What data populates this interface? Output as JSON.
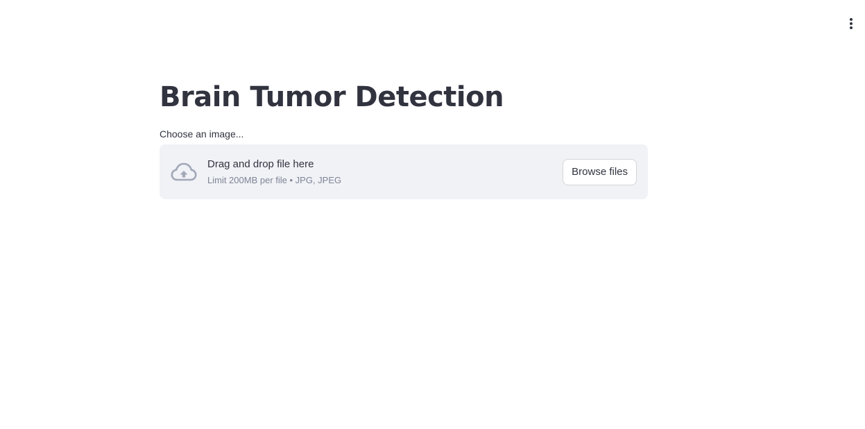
{
  "header": {
    "menu_icon": "vertical-dots-icon"
  },
  "main": {
    "title": "Brain Tumor Detection",
    "uploader": {
      "label": "Choose an image...",
      "drop_title": "Drag and drop file here",
      "limit_text": "Limit 200MB per file • JPG, JPEG",
      "browse_label": "Browse files",
      "icon": "cloud-upload-icon"
    }
  },
  "colors": {
    "text": "#31333f",
    "muted_text": "#808495",
    "dropzone_bg": "#f0f2f6",
    "icon": "#a3a8b8"
  }
}
